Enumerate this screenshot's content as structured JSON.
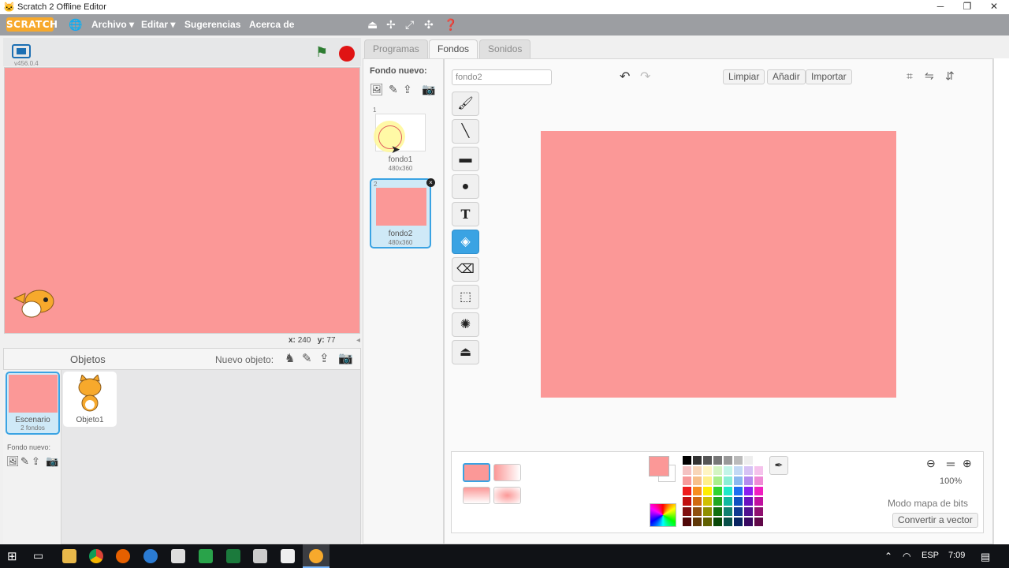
{
  "window": {
    "title": "Scratch 2 Offline Editor",
    "minimize": "─",
    "restore": "❐",
    "close": "✕"
  },
  "menu": {
    "logo": "SCRATCH",
    "archivo": "Archivo ▾",
    "editar": "Editar ▾",
    "sugerencias": "Sugerencias",
    "acerca": "Acerca de"
  },
  "stage": {
    "version": "v456.0.4",
    "x_label": "x:",
    "x_value": "240",
    "y_label": "y:",
    "y_value": "77",
    "background_color": "#fb9897"
  },
  "sprites": {
    "header": "Objetos",
    "new_sprite_label": "Nuevo objeto:",
    "stage_tile_name": "Escenario",
    "stage_tile_sub": "2 fondos",
    "sprite_name": "Objeto1",
    "new_backdrop_label": "Fondo nuevo:"
  },
  "tabs": [
    "Programas",
    "Fondos",
    "Sonidos"
  ],
  "costumes": {
    "new_label": "Fondo nuevo:",
    "items": [
      {
        "index": "1",
        "name": "fondo1",
        "size": "480x360"
      },
      {
        "index": "2",
        "name": "fondo2",
        "size": "480x360"
      }
    ]
  },
  "editor": {
    "name_value": "fondo2",
    "clear": "Limpiar",
    "add": "Añadir",
    "import": "Importar",
    "zoom": "100%",
    "mode": "Modo mapa de bits",
    "convert": "Convertir a vector",
    "current_color": "#fb9897"
  },
  "taskbar": {
    "lang": "ESP",
    "time": "7:09"
  }
}
